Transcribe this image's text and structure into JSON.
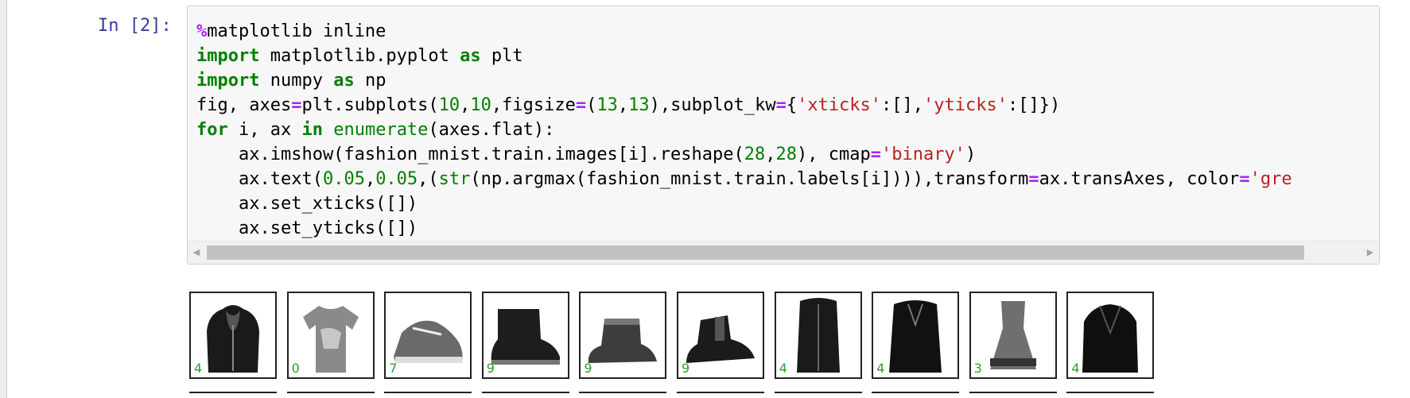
{
  "cell": {
    "prompt": "In [2]:",
    "code_lines": [
      [
        {
          "t": "%",
          "c": "op"
        },
        {
          "t": "matplotlib inline"
        }
      ],
      [
        {
          "t": "import",
          "c": "kw"
        },
        {
          "t": " matplotlib.pyplot "
        },
        {
          "t": "as",
          "c": "kw"
        },
        {
          "t": " plt"
        }
      ],
      [
        {
          "t": "import",
          "c": "kw"
        },
        {
          "t": " numpy "
        },
        {
          "t": "as",
          "c": "kw"
        },
        {
          "t": " np"
        }
      ],
      [
        {
          "t": "fig, axes"
        },
        {
          "t": "=",
          "c": "op"
        },
        {
          "t": "plt.subplots("
        },
        {
          "t": "10",
          "c": "num"
        },
        {
          "t": ","
        },
        {
          "t": "10",
          "c": "num"
        },
        {
          "t": ",figsize"
        },
        {
          "t": "=",
          "c": "op"
        },
        {
          "t": "("
        },
        {
          "t": "13",
          "c": "num"
        },
        {
          "t": ","
        },
        {
          "t": "13",
          "c": "num"
        },
        {
          "t": "),subplot_kw"
        },
        {
          "t": "=",
          "c": "op"
        },
        {
          "t": "{"
        },
        {
          "t": "'xticks'",
          "c": "str"
        },
        {
          "t": ":[],"
        },
        {
          "t": "'yticks'",
          "c": "str"
        },
        {
          "t": ":[]})"
        }
      ],
      [
        {
          "t": "for",
          "c": "kw"
        },
        {
          "t": " i, ax "
        },
        {
          "t": "in",
          "c": "kw"
        },
        {
          "t": " "
        },
        {
          "t": "enumerate",
          "c": "bi"
        },
        {
          "t": "(axes.flat):"
        }
      ],
      [
        {
          "t": "    ax.imshow(fashion_mnist.train.images[i].reshape("
        },
        {
          "t": "28",
          "c": "num"
        },
        {
          "t": ","
        },
        {
          "t": "28",
          "c": "num"
        },
        {
          "t": "), cmap"
        },
        {
          "t": "=",
          "c": "op"
        },
        {
          "t": "'binary'",
          "c": "str"
        },
        {
          "t": ")"
        }
      ],
      [
        {
          "t": "    ax.text("
        },
        {
          "t": "0.05",
          "c": "num"
        },
        {
          "t": ","
        },
        {
          "t": "0.05",
          "c": "num"
        },
        {
          "t": ",("
        },
        {
          "t": "str",
          "c": "bi"
        },
        {
          "t": "(np.argmax(fashion_mnist.train.labels[i]))),transform"
        },
        {
          "t": "=",
          "c": "op"
        },
        {
          "t": "ax.transAxes, color"
        },
        {
          "t": "=",
          "c": "op"
        },
        {
          "t": "'gre",
          "c": "str"
        }
      ],
      [
        {
          "t": "    ax.set_xticks([])"
        }
      ],
      [
        {
          "t": "    ax.set_yticks([])"
        }
      ]
    ],
    "scrollbar": {
      "left_arrow": "◀",
      "right_arrow": "▶"
    }
  },
  "output": {
    "label_color": "#2e9e2e",
    "thumbnails": [
      {
        "label": "4",
        "kind": "hoodie"
      },
      {
        "label": "0",
        "kind": "tshirt"
      },
      {
        "label": "7",
        "kind": "sneaker"
      },
      {
        "label": "9",
        "kind": "boot"
      },
      {
        "label": "9",
        "kind": "ugg"
      },
      {
        "label": "9",
        "kind": "chelsea"
      },
      {
        "label": "4",
        "kind": "coat"
      },
      {
        "label": "4",
        "kind": "coat2"
      },
      {
        "label": "3",
        "kind": "dress"
      },
      {
        "label": "4",
        "kind": "jacket"
      }
    ]
  }
}
